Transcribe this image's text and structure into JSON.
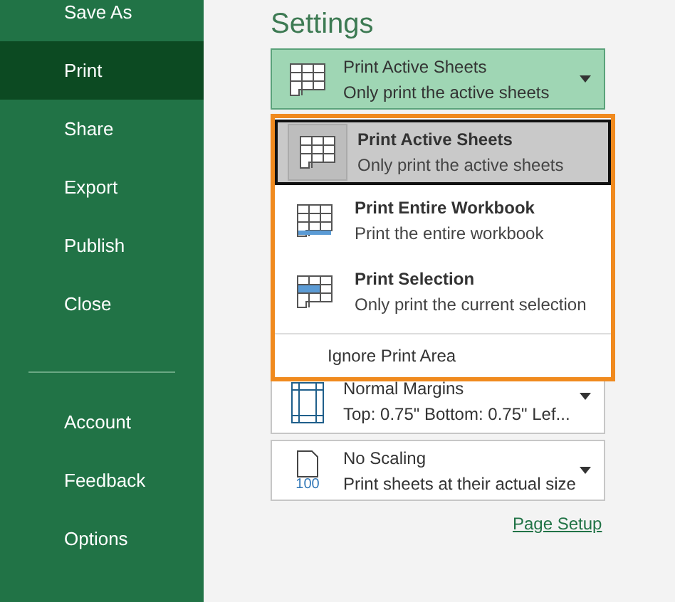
{
  "sidebar": {
    "items": [
      {
        "label": "Save As",
        "selected": false
      },
      {
        "label": "Print",
        "selected": true
      },
      {
        "label": "Share",
        "selected": false
      },
      {
        "label": "Export",
        "selected": false
      },
      {
        "label": "Publish",
        "selected": false
      },
      {
        "label": "Close",
        "selected": false
      }
    ],
    "bottom_items": [
      {
        "label": "Account",
        "selected": false
      },
      {
        "label": "Feedback",
        "selected": false
      },
      {
        "label": "Options",
        "selected": false
      }
    ]
  },
  "settings": {
    "title": "Settings",
    "print_what": {
      "label": "Print Active Sheets",
      "description": "Only print the active sheets",
      "expanded": true
    },
    "menu": {
      "options": [
        {
          "kind": "sheets",
          "label": "Print Active Sheets",
          "description": "Only print the active sheets",
          "selected": true
        },
        {
          "kind": "workbook",
          "label": "Print Entire Workbook",
          "description": "Print the entire workbook",
          "selected": false
        },
        {
          "kind": "selection",
          "label": "Print Selection",
          "description": "Only print the current selection",
          "selected": false
        }
      ],
      "extra": "Ignore Print Area"
    },
    "margins": {
      "label": "Normal Margins",
      "description": "Top: 0.75\" Bottom: 0.75\" Lef..."
    },
    "scaling": {
      "label": "No Scaling",
      "description": "Print sheets at their actual size",
      "icon_text": "100"
    },
    "link": "Page Setup"
  }
}
